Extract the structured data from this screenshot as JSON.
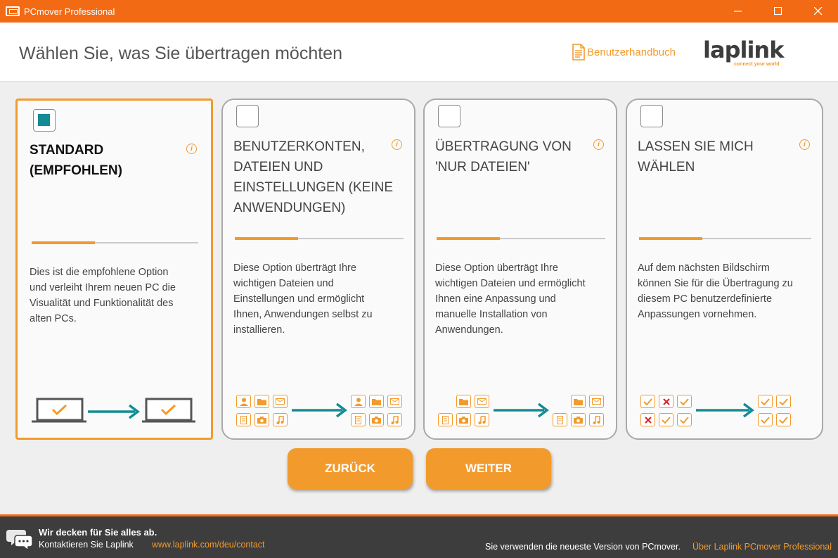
{
  "window": {
    "title": "PCmover Professional",
    "controls": [
      "minimize-icon",
      "maximize-icon",
      "close-icon"
    ]
  },
  "header": {
    "title": "Wählen Sie, was Sie übertragen möchten",
    "manual_link": "Benutzerhandbuch",
    "logo_text": "laplink",
    "logo_tagline": "connect your world"
  },
  "options": [
    {
      "title_lines": [
        "STANDARD",
        "(EMPFOHLEN)"
      ],
      "description_lines": [
        "Dies ist die empfohlene Option",
        "und verleiht Ihrem neuen PC die",
        "Visualität und Funktionalität des",
        "alten PCs."
      ],
      "selected": true
    },
    {
      "title_lines": [
        "BENUTZERKONTEN,",
        "DATEIEN UND",
        "EINSTELLUNGEN (KEINE",
        "ANWENDUNGEN)"
      ],
      "description_lines": [
        "Diese Option überträgt Ihre",
        "wichtigen Dateien und",
        "Einstellungen und ermöglicht",
        "Ihnen, Anwendungen selbst zu",
        "installieren."
      ],
      "selected": false
    },
    {
      "title_lines": [
        "ÜBERTRAGUNG VON",
        "'NUR DATEIEN'"
      ],
      "description_lines": [
        "Diese Option überträgt Ihre",
        "wichtigen Dateien und ermöglicht",
        "Ihnen eine Anpassung und",
        "manuelle Installation von",
        "Anwendungen."
      ],
      "selected": false
    },
    {
      "title_lines": [
        "LASSEN SIE MICH",
        "WÄHLEN"
      ],
      "description_lines": [
        "Auf dem nächsten Bildschirm",
        "können Sie für die Übertragung zu",
        "diesem PC benutzerdefinierte",
        "Anpassungen vornehmen."
      ],
      "selected": false
    }
  ],
  "buttons": {
    "back": "ZURÜCK",
    "next": "WEITER"
  },
  "footer": {
    "cover": "Wir decken für Sie alles ab.",
    "contact": "Kontaktieren Sie Laplink",
    "contact_link": "www.laplink.com/deu/contact",
    "version": "Sie verwenden die neueste Version von PCmover.",
    "about": "Über Laplink PCmover Professional"
  },
  "colors": {
    "accent": "#f39a2c",
    "titlebar": "#f26a13",
    "teal": "#138c95",
    "footer": "#3d3d3d",
    "check_green": "#f39a2c",
    "cross_red": "#d9262c"
  }
}
